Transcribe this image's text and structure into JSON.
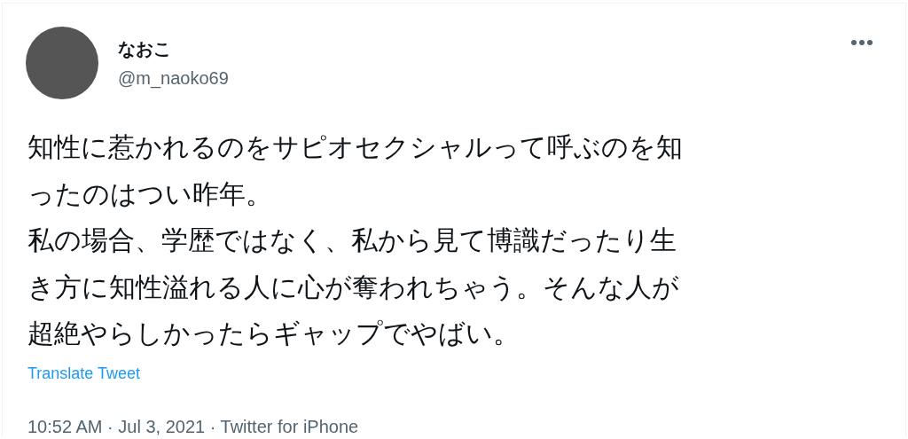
{
  "author": {
    "name": "なおこ",
    "handle": "@m_naoko69"
  },
  "tweet": {
    "lines": [
      "知性に惹かれるのをサピオセクシャルって呼ぶのを知",
      "ったのはつい昨年。",
      "私の場合、学歴ではなく、私から見て博識だったり生",
      "き方に知性溢れる人に心が奪われちゃう。そんな人が",
      "超絶やらしかったらギャップでやばい。"
    ]
  },
  "translate_link": "Translate Tweet",
  "meta": "10:52 AM · Jul 3, 2021 · Twitter for iPhone"
}
